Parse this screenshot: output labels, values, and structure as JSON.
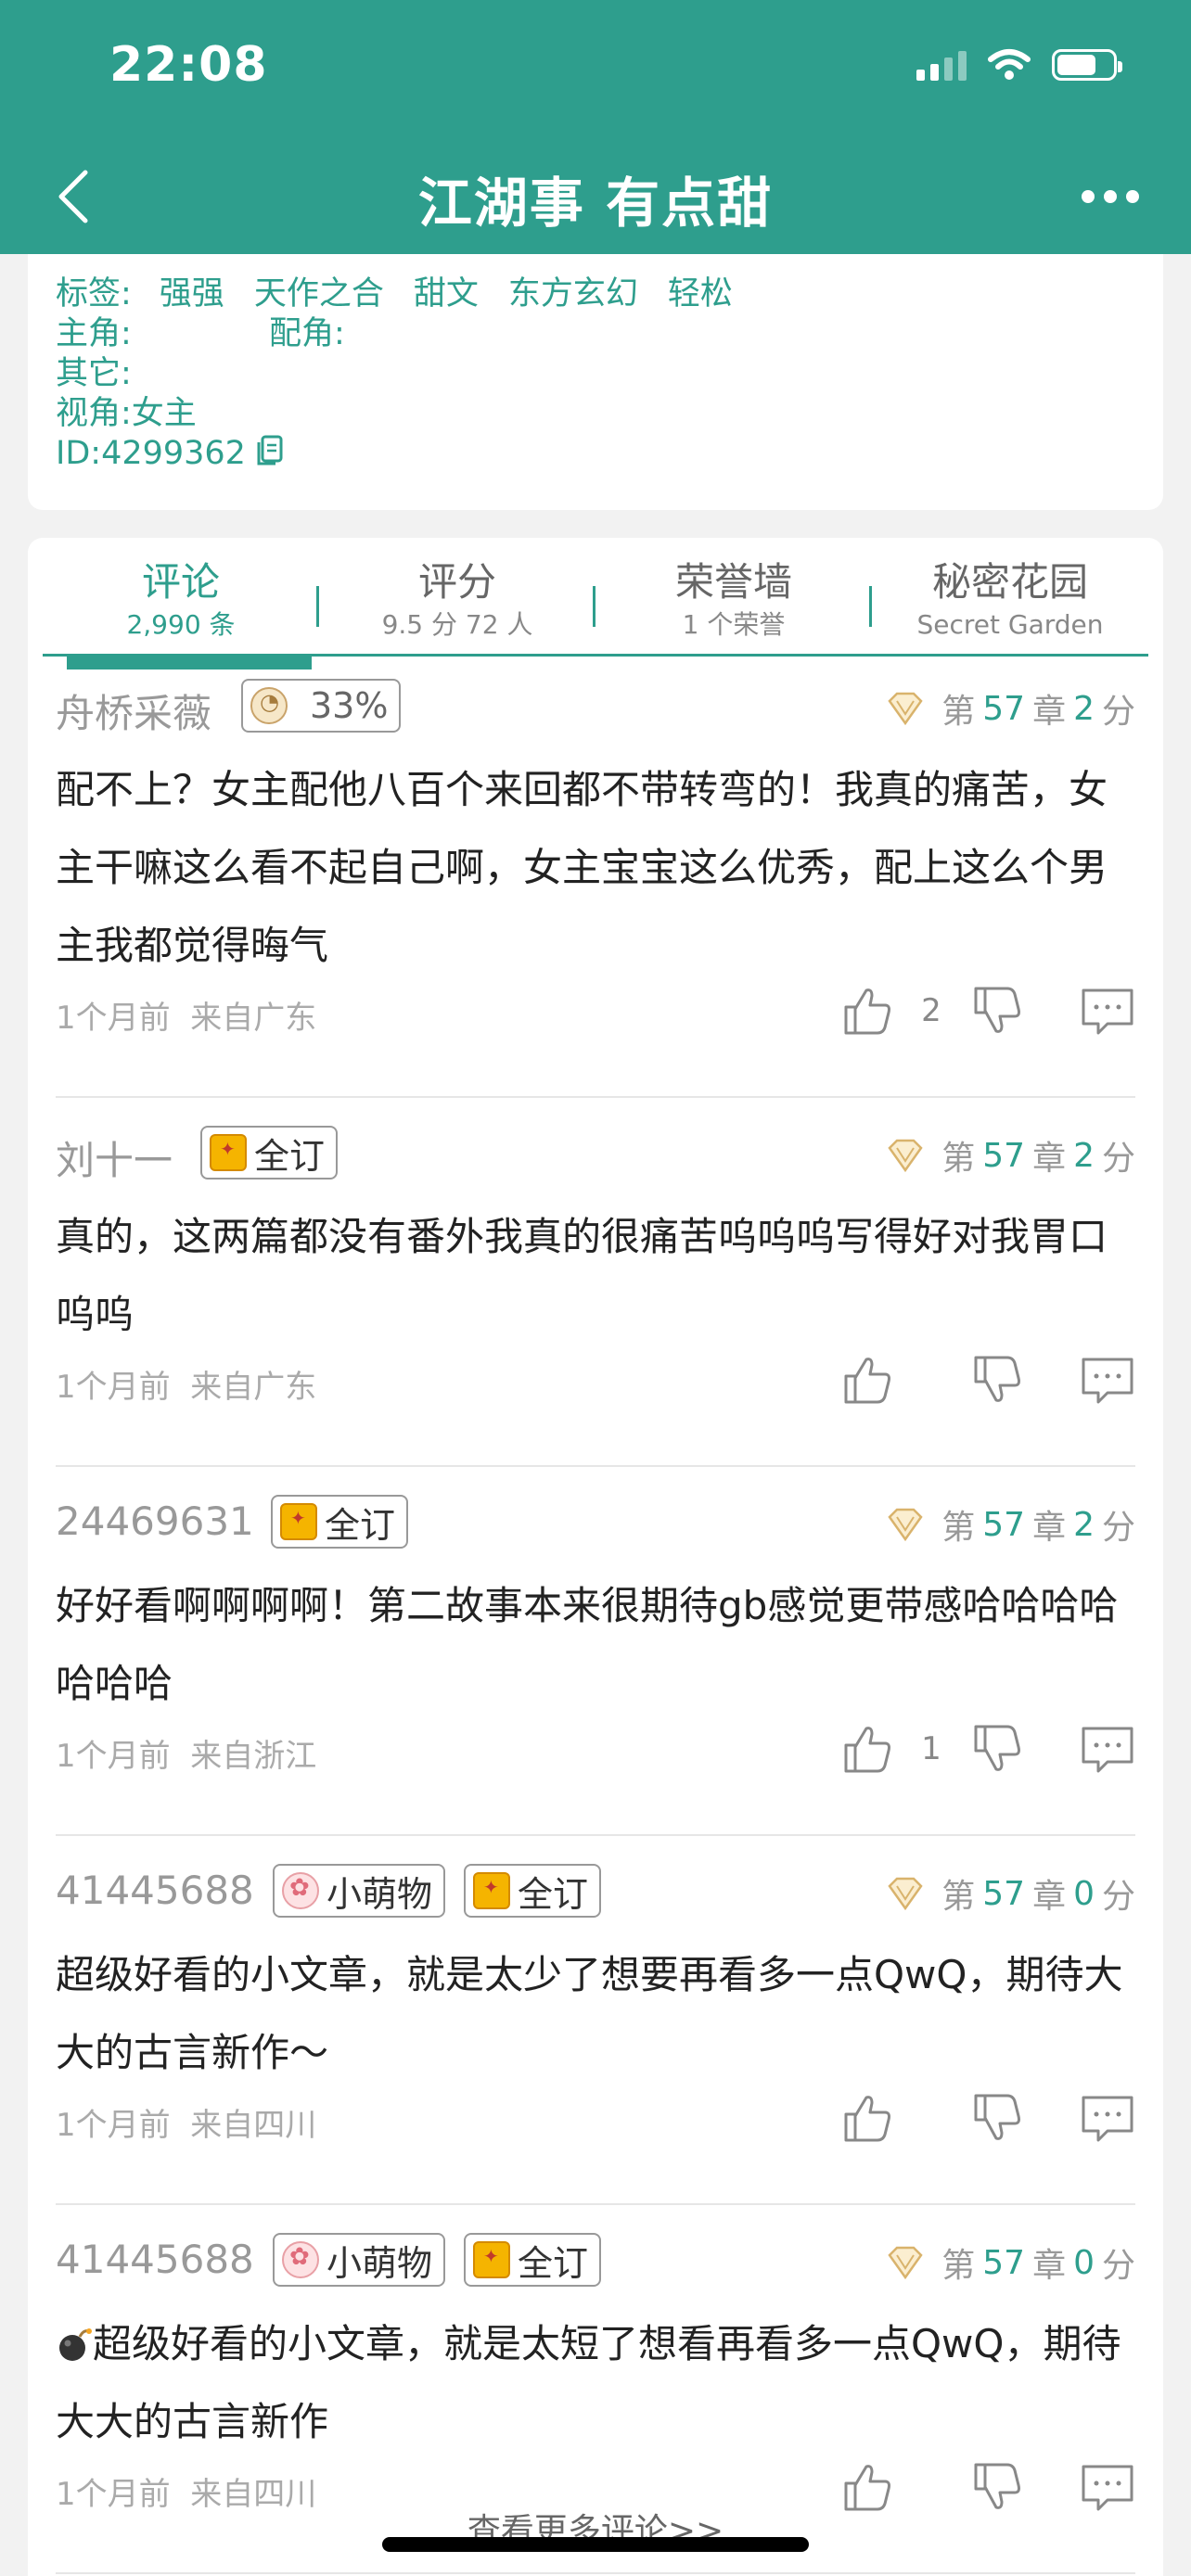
{
  "status_bar": {
    "time": "22:08"
  },
  "nav": {
    "title": "江湖事  有点甜"
  },
  "info": {
    "tags_label": "标签:",
    "tags": [
      "强强",
      "天作之合",
      "甜文",
      "东方玄幻",
      "轻松"
    ],
    "protagonist_label": "主角:",
    "supporting_label": "配角:",
    "other_label": "其它:",
    "viewpoint": "视角:女主",
    "id": "ID:4299362"
  },
  "tabs": [
    {
      "label": "评论",
      "sub": "2,990 条"
    },
    {
      "label": "评分",
      "sub": "9.5 分 72 人"
    },
    {
      "label": "荣誉墙",
      "sub": "1 个荣誉"
    },
    {
      "label": "秘密花园",
      "sub": "Secret Garden"
    }
  ],
  "comment_meta_labels": {
    "chapter_prefix": "第",
    "chapter_suffix": "章",
    "score_suffix": "分"
  },
  "comments": [
    {
      "user": "舟桥采薇",
      "badges": [
        {
          "icon": "shell-icon",
          "text": "33%"
        }
      ],
      "chapter": "57",
      "score": "2",
      "text": "配不上？女主配他八百个来回都不带转弯的！我真的痛苦，女主干嘛这么看不起自己啊，女主宝宝这么优秀，配上这么个男主我都觉得晦气",
      "time": "1个月前",
      "location": "来自广东",
      "likes": "2"
    },
    {
      "user": "刘十一",
      "badges": [
        {
          "icon": "subscribe-icon",
          "text": "全订"
        }
      ],
      "chapter": "57",
      "score": "2",
      "text": "真的，这两篇都没有番外我真的很痛苦呜呜呜写得好对我胃口呜呜",
      "time": "1个月前",
      "location": "来自广东",
      "likes": ""
    },
    {
      "user": "24469631",
      "badges": [
        {
          "icon": "subscribe-icon",
          "text": "全订"
        }
      ],
      "chapter": "57",
      "score": "2",
      "text": "好好看啊啊啊啊！第二故事本来很期待gb感觉更带感哈哈哈哈哈哈哈",
      "time": "1个月前",
      "location": "来自浙江",
      "likes": "1"
    },
    {
      "user": "41445688",
      "badges": [
        {
          "icon": "paw-icon",
          "text": "小萌物"
        },
        {
          "icon": "subscribe-icon",
          "text": "全订"
        }
      ],
      "chapter": "57",
      "score": "0",
      "text": "超级好看的小文章，就是太少了想要再看多一点QwQ，期待大大的古言新作～",
      "time": "1个月前",
      "location": "来自四川",
      "likes": ""
    },
    {
      "user": "41445688",
      "badges": [
        {
          "icon": "paw-icon",
          "text": "小萌物"
        },
        {
          "icon": "subscribe-icon",
          "text": "全订"
        }
      ],
      "chapter": "57",
      "score": "0",
      "text": "超级好看的小文章，就是太短了想看再看多一点QwQ，期待大大的古言新作",
      "time": "1个月前",
      "location": "来自四川",
      "likes": ""
    }
  ],
  "more_link": "查看更多评论>>",
  "colors": {
    "brand": "#2e9e8d",
    "background": "#f2f2f2"
  }
}
